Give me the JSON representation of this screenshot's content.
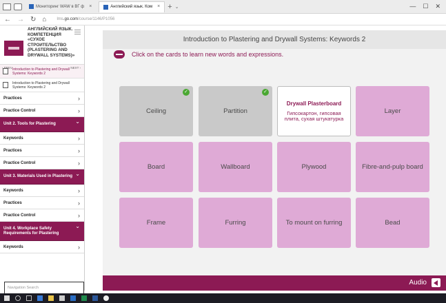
{
  "browser": {
    "tabs": [
      {
        "label": "Мониторинг WAW в ВГ ф",
        "active": false
      },
      {
        "label": "Английский язык. Ком",
        "active": true
      }
    ],
    "url_host": "lms",
    "url_domain": ".go.com",
    "url_path": "/course/1146/P1056"
  },
  "sidebar": {
    "course_title": "АНГЛИЙСКИЙ ЯЗЫК. КОМПЕТЕНЦИЯ «СУХОЕ СТРОИТЕЛЬСТВО (PLASTERING AND DRYWALL SYSTEMS)»",
    "prev_label": "‹ PREV",
    "next_label": "NEXT ›",
    "lessons": [
      {
        "label": "Introduction to Plastering and Drywall Systems: Keywords 2",
        "active": true
      },
      {
        "label": "Introduction to Plastering and Drywall Systems: Keywords 2",
        "active": false
      }
    ],
    "items": [
      {
        "label": "Practices"
      },
      {
        "label": "Practice Control"
      }
    ],
    "unit2": {
      "label": "Unit 2. Tools for Plastering"
    },
    "unit2_items": [
      {
        "label": "Keywords"
      },
      {
        "label": "Practices"
      },
      {
        "label": "Practice Control"
      }
    ],
    "unit3": {
      "label": "Unit 3. Materials Used in Plastering"
    },
    "unit3_items": [
      {
        "label": "Keywords"
      },
      {
        "label": "Practices"
      },
      {
        "label": "Practice Control"
      }
    ],
    "unit4": {
      "label": "Unit 4. Workplace Safety Requirements for Plastering"
    },
    "unit4_items": [
      {
        "label": "Keywords"
      }
    ],
    "search_placeholder": "Navigation Search"
  },
  "main": {
    "lesson_title": "Introduction to Plastering and Drywall Systems: Keywords 2",
    "instruction": "Click on the cards to learn new words and expressions.",
    "cards": [
      {
        "label": "Ceiling",
        "state": "learned"
      },
      {
        "label": "Partition",
        "state": "learned"
      },
      {
        "label": "Drywall Plasterboard",
        "translation": "Гипсокартон, гипсовая плита, сухая штукатурка",
        "state": "open"
      },
      {
        "label": "Layer",
        "state": "new"
      },
      {
        "label": "Board",
        "state": "new"
      },
      {
        "label": "Wallboard",
        "state": "new"
      },
      {
        "label": "Plywood",
        "state": "new"
      },
      {
        "label": "Fibre-and-pulp board",
        "state": "new"
      },
      {
        "label": "Frame",
        "state": "new"
      },
      {
        "label": "Furring",
        "state": "new"
      },
      {
        "label": "To mount on furring",
        "state": "new"
      },
      {
        "label": "Bead",
        "state": "new"
      }
    ],
    "audio_label": "Audio"
  },
  "colors": {
    "brand": "#8c1a54",
    "card_new": "#dfaad6",
    "card_learned": "#c9c9c9",
    "check": "#4aa832"
  }
}
